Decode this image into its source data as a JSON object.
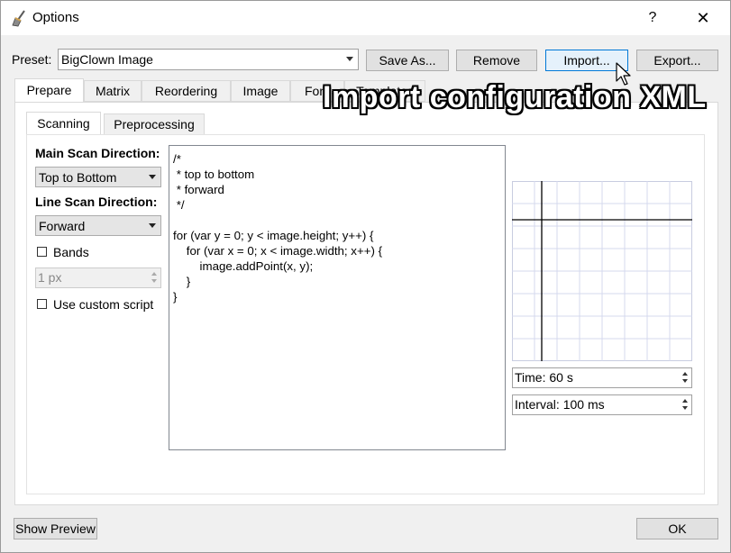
{
  "window": {
    "title": "Options",
    "help_label": "?",
    "close_label": "✕",
    "icon": "broom-icon"
  },
  "preset": {
    "label": "Preset:",
    "value": "BigClown Image",
    "save_as_label": "Save As...",
    "remove_label": "Remove",
    "import_label": "Import...",
    "export_label": "Export..."
  },
  "main_tabs": [
    {
      "label": "Prepare",
      "active": true
    },
    {
      "label": "Matrix"
    },
    {
      "label": "Reordering"
    },
    {
      "label": "Image"
    },
    {
      "label": "Font"
    },
    {
      "label": "Templates"
    }
  ],
  "sub_tabs": [
    {
      "label": "Scanning",
      "active": true
    },
    {
      "label": "Preprocessing"
    }
  ],
  "scanning": {
    "main_direction_label": "Main Scan Direction:",
    "main_direction_value": "Top to Bottom",
    "line_direction_label": "Line Scan Direction:",
    "line_direction_value": "Forward",
    "bands_label": "Bands",
    "bands_checked": false,
    "band_width": "1 px",
    "custom_script_label": "Use custom script",
    "custom_script_checked": false
  },
  "script": "/*\n * top to bottom\n * forward\n */\n\nfor (var y = 0; y < image.height; y++) {\n    for (var x = 0; x < image.width; x++) {\n        image.addPoint(x, y);\n    }\n}",
  "preview_settings": {
    "time": "Time: 60 s",
    "interval": "Interval: 100 ms"
  },
  "footer": {
    "show_preview_label": "Show Preview",
    "ok_label": "OK"
  },
  "overlay_caption": "Import configuration XML"
}
